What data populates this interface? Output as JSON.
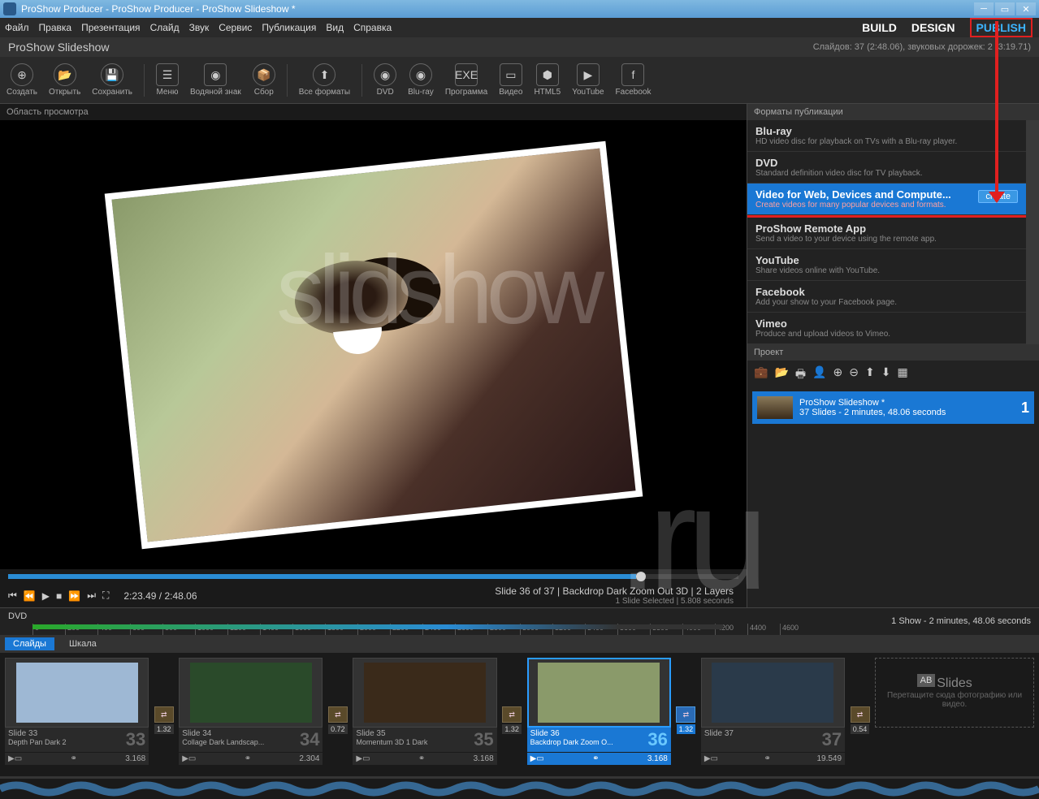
{
  "window": {
    "title": "ProShow Producer - ProShow Producer - ProShow Slideshow *"
  },
  "menu": [
    "Файл",
    "Правка",
    "Презентация",
    "Слайд",
    "Звук",
    "Сервис",
    "Публикация",
    "Вид",
    "Справка"
  ],
  "modes": {
    "build": "BUILD",
    "design": "DESIGN",
    "publish": "PUBLISH"
  },
  "info": {
    "name": "ProShow Slideshow",
    "stats": "Слайдов: 37 (2:48.06), звуковых дорожек: 2 (3:19.71)"
  },
  "toolbar": [
    {
      "id": "create",
      "label": "Создать",
      "glyph": "⊕"
    },
    {
      "id": "open",
      "label": "Открыть",
      "glyph": "📂"
    },
    {
      "id": "save",
      "label": "Сохранить",
      "glyph": "💾"
    },
    {
      "id": "menu",
      "label": "Меню",
      "glyph": "☰",
      "sq": 1
    },
    {
      "id": "watermark",
      "label": "Водяной знак",
      "glyph": "◉",
      "sq": 1
    },
    {
      "id": "collect",
      "label": "Сбор",
      "glyph": "📦"
    },
    {
      "id": "all",
      "label": "Все форматы",
      "glyph": "⬆"
    },
    {
      "id": "dvd",
      "label": "DVD",
      "glyph": "◉"
    },
    {
      "id": "bluray",
      "label": "Blu-ray",
      "glyph": "◉"
    },
    {
      "id": "program",
      "label": "Программа",
      "glyph": "EXE",
      "sq": 1
    },
    {
      "id": "video",
      "label": "Видео",
      "glyph": "▭",
      "sq": 1
    },
    {
      "id": "html5",
      "label": "HTML5",
      "glyph": "⬢",
      "sq": 1
    },
    {
      "id": "youtube",
      "label": "YouTube",
      "glyph": "▶",
      "sq": 1
    },
    {
      "id": "facebook",
      "label": "Facebook",
      "glyph": "f",
      "sq": 1
    }
  ],
  "preview": {
    "label": "Область просмотра",
    "time": "2:23.49 / 2:48.06",
    "slideinfo": "Slide 36 of 37  |  Backdrop Dark Zoom Out 3D  |  2 Layers",
    "slideinfo2": "1 Slide Selected  |  5.808 seconds"
  },
  "formats": {
    "header": "Форматы публикации",
    "items": [
      {
        "t": "Blu-ray",
        "d": "HD video disc for playback on TVs with a Blu-ray player."
      },
      {
        "t": "DVD",
        "d": "Standard definition video disc for TV playback."
      },
      {
        "t": "Video for Web, Devices and Compute...",
        "d": "Create videos for many popular devices and formats.",
        "sel": 1,
        "create": "create"
      },
      {
        "t": "ProShow Remote App",
        "d": "Send a video to your device using the remote app."
      },
      {
        "t": "YouTube",
        "d": "Share videos online with YouTube."
      },
      {
        "t": "Facebook",
        "d": "Add your show to your Facebook page."
      },
      {
        "t": "Vimeo",
        "d": "Produce and upload videos to Vimeo."
      }
    ]
  },
  "project": {
    "header": "Проект",
    "item": {
      "name": "ProShow Slideshow *",
      "detail": "37 Slides - 2 minutes, 48.06 seconds",
      "num": "1"
    }
  },
  "ruler": {
    "label": "DVD",
    "marks": [
      "0",
      "200",
      "400",
      "600",
      "800",
      "1000",
      "1200",
      "1400",
      "1600",
      "1800",
      "2000",
      "2200",
      "2400",
      "2600",
      "2800",
      "3000",
      "3200",
      "3400",
      "3600",
      "3800",
      "4000",
      "4200",
      "4400",
      "4600"
    ],
    "showinfo": "1 Show - 2 minutes, 48.06 seconds"
  },
  "tabs": {
    "slides": "Слайды",
    "scale": "Шкала"
  },
  "slides": [
    {
      "n": "33",
      "title": "Slide 33",
      "sub": "Depth Pan Dark 2",
      "dur": "3.168",
      "trans": "1.32",
      "bg": "#9eb8d4"
    },
    {
      "n": "34",
      "title": "Slide 34",
      "sub": "Collage Dark Landscap...",
      "dur": "2.304",
      "trans": "0.72",
      "bg": "#2a4a2a"
    },
    {
      "n": "35",
      "title": "Slide 35",
      "sub": "Momentum 3D 1 Dark",
      "dur": "3.168",
      "trans": "1.32",
      "bg": "#3a2a1a"
    },
    {
      "n": "36",
      "title": "Slide 36",
      "sub": "Backdrop Dark Zoom O...",
      "dur": "3.168",
      "trans": "1.32",
      "sel": 1,
      "bg": "#8a9a6a"
    },
    {
      "n": "37",
      "title": "Slide 37",
      "sub": "",
      "dur": "19.549",
      "trans": "0.54",
      "bg": "#2a3a4a"
    }
  ],
  "addslide": {
    "title": "Slides",
    "hint": "Перетащите сюда фотографию или видео."
  }
}
